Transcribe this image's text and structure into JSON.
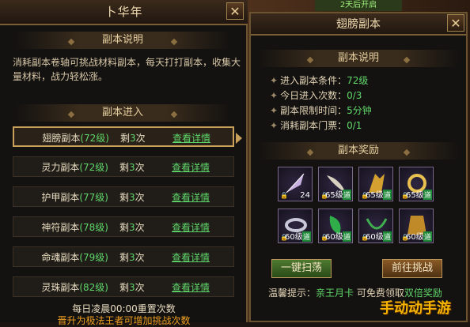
{
  "left_panel": {
    "title": "卜华年",
    "close": "✕",
    "desc_header": "副本说明",
    "desc_text": "消耗副本卷轴可挑战材料副本，每天打打副本，收集大量材料，战力轻松涨。",
    "enter_header": "副本进入",
    "dungeons": [
      {
        "name": "翅膀副本",
        "level": "(72级)",
        "remain_prefix": "剩",
        "remain_n": "3",
        "remain_suffix": "次",
        "detail": "查看详情"
      },
      {
        "name": "灵力副本",
        "level": "(72级)",
        "remain_prefix": "剩",
        "remain_n": "3",
        "remain_suffix": "次",
        "detail": "查看详情"
      },
      {
        "name": "护甲副本",
        "level": "(77级)",
        "remain_prefix": "剩",
        "remain_n": "3",
        "remain_suffix": "次",
        "detail": "查看详情"
      },
      {
        "name": "神符副本",
        "level": "(78级)",
        "remain_prefix": "剩",
        "remain_n": "3",
        "remain_suffix": "次",
        "detail": "查看详情"
      },
      {
        "name": "命魂副本",
        "level": "(79级)",
        "remain_prefix": "剩",
        "remain_n": "3",
        "remain_suffix": "次",
        "detail": "查看详情"
      },
      {
        "name": "灵珠副本",
        "level": "(82级)",
        "remain_prefix": "剩",
        "remain_n": "3",
        "remain_suffix": "次",
        "detail": "查看详情"
      }
    ],
    "footer1": "每日凌晨00:00重置次数",
    "footer2": "晋升为极法王者可增加挑战次数"
  },
  "right_panel": {
    "title": "翅膀副本",
    "close": "✕",
    "top_badge": "2天后开启",
    "desc_header": "副本说明",
    "info": [
      {
        "label": "进入副本条件：",
        "value": "72级"
      },
      {
        "label": "今日进入次数：",
        "value": "0/3"
      },
      {
        "label": "副本限制时间：",
        "value": "5分钟"
      },
      {
        "label": "消耗副本门票：",
        "value": "0/1"
      }
    ],
    "reward_header": "副本奖励",
    "rewards": [
      {
        "icon": "feather-icon",
        "count": "24",
        "level": "",
        "tag": ""
      },
      {
        "icon": "blade-wing-icon",
        "count": "",
        "level": "65级",
        "tag": "道"
      },
      {
        "icon": "golden-wing-icon",
        "count": "",
        "level": "65级",
        "tag": "道"
      },
      {
        "icon": "gold-ring-icon",
        "count": "",
        "level": "65级",
        "tag": "道"
      },
      {
        "icon": "bracelet-icon",
        "count": "",
        "level": "60级",
        "tag": "道"
      },
      {
        "icon": "green-wing-icon",
        "count": "",
        "level": "60级",
        "tag": "道"
      },
      {
        "icon": "jade-necklace-icon",
        "count": "",
        "level": "60级",
        "tag": "道"
      },
      {
        "icon": "gold-armor-icon",
        "count": "",
        "level": "60级",
        "tag": "道"
      }
    ],
    "btn_sweep": "一键扫荡",
    "btn_challenge": "前往挑战",
    "tip_prefix": "温馨提示：",
    "tip_card": "亲王月卡",
    "tip_mid": "可免费领取",
    "tip_reward": "双倍奖励"
  },
  "watermark": "手动动手游",
  "colors": {
    "accent_green": "#5fd66a",
    "gold": "#c9a05a",
    "orange": "#f0a020"
  }
}
